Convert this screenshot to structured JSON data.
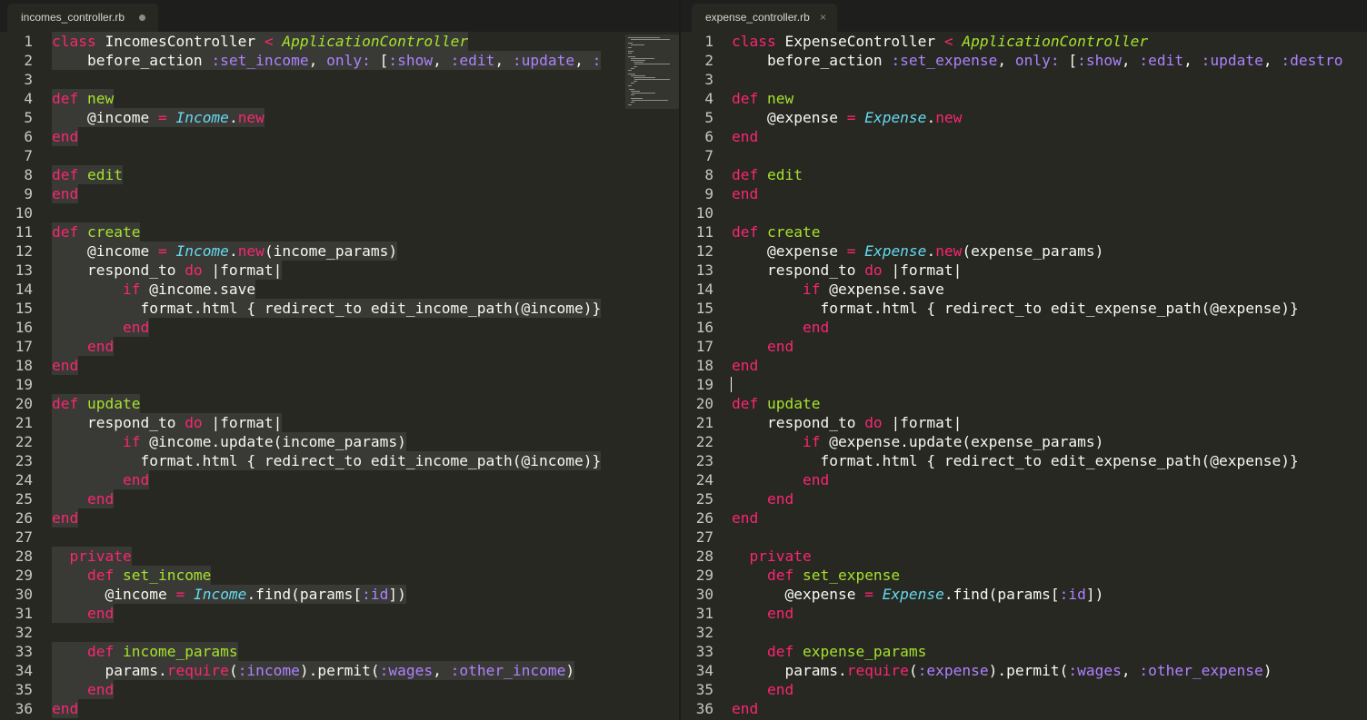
{
  "left_pane": {
    "tab_title": "incomes_controller.rb",
    "line_numbers": [
      "1",
      "2",
      "3",
      "4",
      "5",
      "6",
      "7",
      "8",
      "9",
      "10",
      "11",
      "12",
      "13",
      "14",
      "15",
      "16",
      "17",
      "18",
      "19",
      "20",
      "21",
      "22",
      "23",
      "24",
      "25",
      "26",
      "27",
      "28",
      "29",
      "30",
      "31",
      "32",
      "33",
      "34",
      "35",
      "36"
    ],
    "lines": [
      [
        {
          "t": "class ",
          "c": "k"
        },
        {
          "t": "IncomesController "
        },
        {
          "t": "< ",
          "c": "k"
        },
        {
          "t": "ApplicationController",
          "c": "i"
        }
      ],
      [
        {
          "t": "    before_action "
        },
        {
          "t": ":set_income",
          "c": "s"
        },
        {
          "t": ", "
        },
        {
          "t": "only:",
          "c": "s"
        },
        {
          "t": " [",
          "c": ""
        },
        {
          "t": ":show",
          "c": "s"
        },
        {
          "t": ", "
        },
        {
          "t": ":edit",
          "c": "s"
        },
        {
          "t": ", "
        },
        {
          "t": ":update",
          "c": "s"
        },
        {
          "t": ", "
        },
        {
          "t": ":",
          "c": "s"
        }
      ],
      [],
      [
        {
          "t": "def ",
          "c": "k"
        },
        {
          "t": "new",
          "c": "c"
        }
      ],
      [
        {
          "t": "    @income "
        },
        {
          "t": "= ",
          "c": "k"
        },
        {
          "t": "Income",
          "c": "t"
        },
        {
          "t": "."
        },
        {
          "t": "new",
          "c": "k"
        }
      ],
      [
        {
          "t": "end",
          "c": "k"
        }
      ],
      [],
      [
        {
          "t": "def ",
          "c": "k"
        },
        {
          "t": "edit",
          "c": "c"
        }
      ],
      [
        {
          "t": "end",
          "c": "k"
        }
      ],
      [],
      [
        {
          "t": "def ",
          "c": "k"
        },
        {
          "t": "create",
          "c": "c"
        }
      ],
      [
        {
          "t": "    @income "
        },
        {
          "t": "= ",
          "c": "k"
        },
        {
          "t": "Income",
          "c": "t"
        },
        {
          "t": "."
        },
        {
          "t": "new",
          "c": "k"
        },
        {
          "t": "(income_params)"
        }
      ],
      [
        {
          "t": "    respond_to "
        },
        {
          "t": "do ",
          "c": "k"
        },
        {
          "t": "|format|"
        }
      ],
      [
        {
          "t": "        "
        },
        {
          "t": "if ",
          "c": "k"
        },
        {
          "t": "@income.save"
        }
      ],
      [
        {
          "t": "          format.html { redirect_to edit_income_path(@income)}"
        }
      ],
      [
        {
          "t": "        "
        },
        {
          "t": "end",
          "c": "k"
        }
      ],
      [
        {
          "t": "    "
        },
        {
          "t": "end",
          "c": "k"
        }
      ],
      [
        {
          "t": "end",
          "c": "k"
        }
      ],
      [],
      [
        {
          "t": "def ",
          "c": "k"
        },
        {
          "t": "update",
          "c": "c"
        }
      ],
      [
        {
          "t": "    respond_to "
        },
        {
          "t": "do ",
          "c": "k"
        },
        {
          "t": "|format|"
        }
      ],
      [
        {
          "t": "        "
        },
        {
          "t": "if ",
          "c": "k"
        },
        {
          "t": "@income.update(income_params)"
        }
      ],
      [
        {
          "t": "          format.html { redirect_to edit_income_path(@income)}"
        }
      ],
      [
        {
          "t": "        "
        },
        {
          "t": "end",
          "c": "k"
        }
      ],
      [
        {
          "t": "    "
        },
        {
          "t": "end",
          "c": "k"
        }
      ],
      [
        {
          "t": "end",
          "c": "k"
        }
      ],
      [],
      [
        {
          "t": "  "
        },
        {
          "t": "private",
          "c": "k"
        }
      ],
      [
        {
          "t": "    "
        },
        {
          "t": "def ",
          "c": "k"
        },
        {
          "t": "set_income",
          "c": "c"
        }
      ],
      [
        {
          "t": "      @income "
        },
        {
          "t": "= ",
          "c": "k"
        },
        {
          "t": "Income",
          "c": "t"
        },
        {
          "t": ".find(params["
        },
        {
          "t": ":id",
          "c": "s"
        },
        {
          "t": "])"
        }
      ],
      [
        {
          "t": "    "
        },
        {
          "t": "end",
          "c": "k"
        }
      ],
      [],
      [
        {
          "t": "    "
        },
        {
          "t": "def ",
          "c": "k"
        },
        {
          "t": "income_params",
          "c": "c"
        }
      ],
      [
        {
          "t": "      params."
        },
        {
          "t": "require",
          "c": "k"
        },
        {
          "t": "("
        },
        {
          "t": ":income",
          "c": "s"
        },
        {
          "t": ").permit("
        },
        {
          "t": ":wages",
          "c": "s"
        },
        {
          "t": ", "
        },
        {
          "t": ":other_income",
          "c": "s"
        },
        {
          "t": ")"
        }
      ],
      [
        {
          "t": "    "
        },
        {
          "t": "end",
          "c": "k"
        }
      ],
      [
        {
          "t": "end",
          "c": "k"
        }
      ]
    ]
  },
  "right_pane": {
    "tab_title": "expense_controller.rb",
    "tab_close": "×",
    "line_numbers": [
      "1",
      "2",
      "3",
      "4",
      "5",
      "6",
      "7",
      "8",
      "9",
      "10",
      "11",
      "12",
      "13",
      "14",
      "15",
      "16",
      "17",
      "18",
      "19",
      "20",
      "21",
      "22",
      "23",
      "24",
      "25",
      "26",
      "27",
      "28",
      "29",
      "30",
      "31",
      "32",
      "33",
      "34",
      "35",
      "36"
    ],
    "lines": [
      [
        {
          "t": "class ",
          "c": "k"
        },
        {
          "t": "ExpenseController "
        },
        {
          "t": "< ",
          "c": "k"
        },
        {
          "t": "ApplicationController",
          "c": "i"
        }
      ],
      [
        {
          "t": "    before_action "
        },
        {
          "t": ":set_expense",
          "c": "s"
        },
        {
          "t": ", "
        },
        {
          "t": "only:",
          "c": "s"
        },
        {
          "t": " ["
        },
        {
          "t": ":show",
          "c": "s"
        },
        {
          "t": ", "
        },
        {
          "t": ":edit",
          "c": "s"
        },
        {
          "t": ", "
        },
        {
          "t": ":update",
          "c": "s"
        },
        {
          "t": ", "
        },
        {
          "t": ":destro",
          "c": "s"
        }
      ],
      [],
      [
        {
          "t": "def ",
          "c": "k"
        },
        {
          "t": "new",
          "c": "c"
        }
      ],
      [
        {
          "t": "    @expense "
        },
        {
          "t": "= ",
          "c": "k"
        },
        {
          "t": "Expense",
          "c": "t"
        },
        {
          "t": "."
        },
        {
          "t": "new",
          "c": "k"
        }
      ],
      [
        {
          "t": "end",
          "c": "k"
        }
      ],
      [],
      [
        {
          "t": "def ",
          "c": "k"
        },
        {
          "t": "edit",
          "c": "c"
        }
      ],
      [
        {
          "t": "end",
          "c": "k"
        }
      ],
      [],
      [
        {
          "t": "def ",
          "c": "k"
        },
        {
          "t": "create",
          "c": "c"
        }
      ],
      [
        {
          "t": "    @expense "
        },
        {
          "t": "= ",
          "c": "k"
        },
        {
          "t": "Expense",
          "c": "t"
        },
        {
          "t": "."
        },
        {
          "t": "new",
          "c": "k"
        },
        {
          "t": "(expense_params)"
        }
      ],
      [
        {
          "t": "    respond_to "
        },
        {
          "t": "do ",
          "c": "k"
        },
        {
          "t": "|format|"
        }
      ],
      [
        {
          "t": "        "
        },
        {
          "t": "if ",
          "c": "k"
        },
        {
          "t": "@expense.save"
        }
      ],
      [
        {
          "t": "          format.html { redirect_to edit_expense_path(@expense)}"
        }
      ],
      [
        {
          "t": "        "
        },
        {
          "t": "end",
          "c": "k"
        }
      ],
      [
        {
          "t": "    "
        },
        {
          "t": "end",
          "c": "k"
        }
      ],
      [
        {
          "t": "end",
          "c": "k"
        }
      ],
      [],
      [
        {
          "t": "def ",
          "c": "k"
        },
        {
          "t": "update",
          "c": "c"
        }
      ],
      [
        {
          "t": "    respond_to "
        },
        {
          "t": "do ",
          "c": "k"
        },
        {
          "t": "|format|"
        }
      ],
      [
        {
          "t": "        "
        },
        {
          "t": "if ",
          "c": "k"
        },
        {
          "t": "@expense.update(expense_params)"
        }
      ],
      [
        {
          "t": "          format.html { redirect_to edit_expense_path(@expense)}"
        }
      ],
      [
        {
          "t": "        "
        },
        {
          "t": "end",
          "c": "k"
        }
      ],
      [
        {
          "t": "    "
        },
        {
          "t": "end",
          "c": "k"
        }
      ],
      [
        {
          "t": "end",
          "c": "k"
        }
      ],
      [],
      [
        {
          "t": "  "
        },
        {
          "t": "private",
          "c": "k"
        }
      ],
      [
        {
          "t": "    "
        },
        {
          "t": "def ",
          "c": "k"
        },
        {
          "t": "set_expense",
          "c": "c"
        }
      ],
      [
        {
          "t": "      @expense "
        },
        {
          "t": "= ",
          "c": "k"
        },
        {
          "t": "Expense",
          "c": "t"
        },
        {
          "t": ".find(params["
        },
        {
          "t": ":id",
          "c": "s"
        },
        {
          "t": "])"
        }
      ],
      [
        {
          "t": "    "
        },
        {
          "t": "end",
          "c": "k"
        }
      ],
      [],
      [
        {
          "t": "    "
        },
        {
          "t": "def ",
          "c": "k"
        },
        {
          "t": "expense_params",
          "c": "c"
        }
      ],
      [
        {
          "t": "      params."
        },
        {
          "t": "require",
          "c": "k"
        },
        {
          "t": "("
        },
        {
          "t": ":expense",
          "c": "s"
        },
        {
          "t": ").permit("
        },
        {
          "t": ":wages",
          "c": "s"
        },
        {
          "t": ", "
        },
        {
          "t": ":other_expense",
          "c": "s"
        },
        {
          "t": ")"
        }
      ],
      [
        {
          "t": "    "
        },
        {
          "t": "end",
          "c": "k"
        }
      ],
      [
        {
          "t": "end",
          "c": "k"
        }
      ]
    ]
  },
  "theme": {
    "background": "#272822",
    "keyword": "#f92672",
    "function_name": "#a6e22e",
    "type": "#66d9ef",
    "symbol": "#ae81ff",
    "text": "#f8f8f2",
    "selection": "#393a35"
  },
  "icons": {
    "left_tab_status": "modified-dot-icon",
    "right_tab_status": "close-icon",
    "minimap": "minimap"
  }
}
